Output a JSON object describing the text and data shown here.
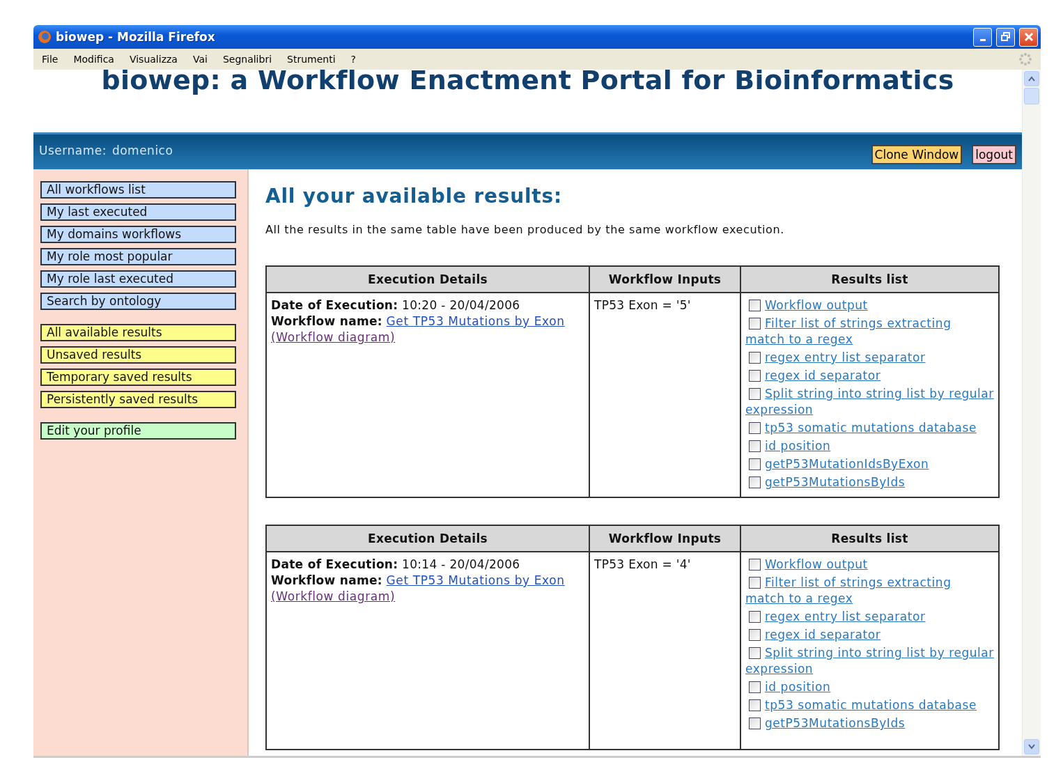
{
  "window": {
    "title": "biowep - Mozilla Firefox"
  },
  "menu": [
    "File",
    "Modifica",
    "Visualizza",
    "Vai",
    "Segnalibri",
    "Strumenti",
    "?"
  ],
  "page": {
    "title": "biowep: a Workflow Enactment Portal for Bioinformatics"
  },
  "user_bar": {
    "username_label": "Username:",
    "username": "domenico",
    "buttons": [
      {
        "label": "Clone Window",
        "kind": "clone"
      },
      {
        "label": "logout",
        "kind": "logout"
      }
    ]
  },
  "sidebar": {
    "groups": [
      {
        "color": "#c4dcfc",
        "items": [
          "All workflows list",
          "My last executed",
          "My domains workflows",
          "My role most popular",
          "My role last executed",
          "Search by ontology"
        ]
      },
      {
        "color": "#fdfd8c",
        "items": [
          "All available results",
          "Unsaved results",
          "Temporary saved results",
          "Persistently saved results"
        ]
      },
      {
        "color": "#c8fcc8",
        "items": [
          "Edit your profile"
        ]
      }
    ]
  },
  "content": {
    "heading": "All your available results:",
    "intro": "All the results in the same table have been produced by the same workflow execution.",
    "tables": [
      {
        "columns": [
          "Execution Details",
          "Workflow Inputs",
          "Results list"
        ],
        "date_label": "Date of Execution:",
        "date": "10:20 - 20/04/2006",
        "workflow_label": "Workflow name:",
        "workflow": "Get TP53 Mutations by Exon",
        "diagram": "(Workflow diagram)",
        "inputs": "TP53 Exon = '5'",
        "results": [
          {
            "label": "Workflow output",
            "checked": false
          },
          {
            "label": "Filter list of strings extracting match to a regex",
            "checked": false
          },
          {
            "label": "regex entry list separator",
            "checked": false
          },
          {
            "label": "regex id separator",
            "checked": false
          },
          {
            "label": "Split string into string list by regular expression",
            "checked": false
          },
          {
            "label": "tp53 somatic mutations database",
            "checked": false
          },
          {
            "label": "id position",
            "checked": false
          },
          {
            "label": "getP53MutationIdsByExon",
            "checked": false
          },
          {
            "label": "getP53MutationsByIds",
            "checked": false
          }
        ]
      },
      {
        "columns": [
          "Execution Details",
          "Workflow Inputs",
          "Results list"
        ],
        "date_label": "Date of Execution:",
        "date": "10:14 - 20/04/2006",
        "workflow_label": "Workflow name:",
        "workflow": "Get TP53 Mutations by Exon",
        "diagram": "(Workflow diagram)",
        "inputs": "TP53 Exon = '4'",
        "results": [
          {
            "label": "Workflow output",
            "checked": false
          },
          {
            "label": "Filter list of strings extracting match to a regex",
            "checked": false
          },
          {
            "label": "regex entry list separator",
            "checked": false
          },
          {
            "label": "regex id separator",
            "checked": false
          },
          {
            "label": "Split string into string list by regular expression",
            "checked": false
          },
          {
            "label": "id position",
            "checked": false
          },
          {
            "label": "tp53 somatic mutations database",
            "checked": false
          },
          {
            "label": "getP53MutationsByIds",
            "checked": false
          }
        ]
      }
    ]
  }
}
